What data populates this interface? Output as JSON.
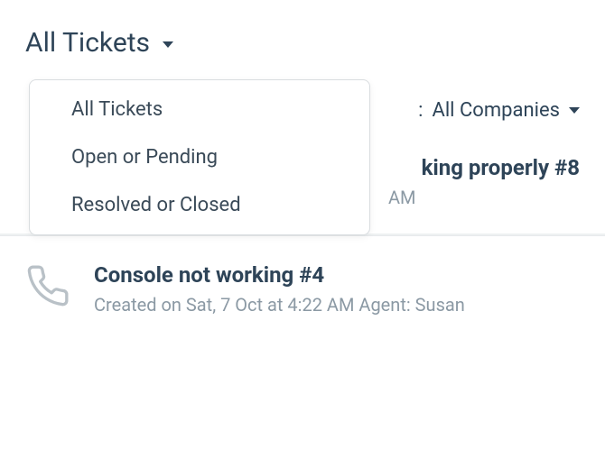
{
  "header": {
    "filter_label": "All Tickets"
  },
  "companies_filter": {
    "prefix": ": ",
    "label": "All Companies"
  },
  "dropdown": {
    "items": [
      {
        "label": "All Tickets"
      },
      {
        "label": "Open or Pending"
      },
      {
        "label": "Resolved or Closed"
      }
    ]
  },
  "tickets": [
    {
      "title_fragment": "king properly #8",
      "meta_fragment": "AM",
      "channel_icon": "ticket-icon"
    },
    {
      "title": "Console not working #4",
      "meta": "Created on Sat, 7 Oct at 4:22 AM Agent: Susan",
      "channel_icon": "phone-icon"
    }
  ]
}
